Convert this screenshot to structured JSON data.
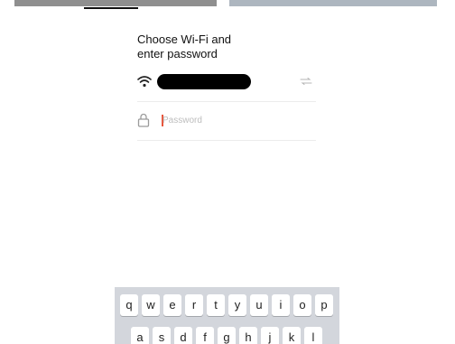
{
  "title": {
    "line1": "Choose Wi-Fi and",
    "line2": "enter password"
  },
  "wifi": {
    "icon": "wifi-icon",
    "network_name_redacted": true,
    "change_icon": "swap-icon"
  },
  "password": {
    "icon": "lock-icon",
    "placeholder": "Password",
    "value": ""
  },
  "keyboard": {
    "row1": [
      "q",
      "w",
      "e",
      "r",
      "t",
      "y",
      "u",
      "i",
      "o",
      "p"
    ],
    "row2": [
      "a",
      "s",
      "d",
      "f",
      "g",
      "h",
      "j",
      "k",
      "l"
    ]
  },
  "colors": {
    "accent_cursor": "#e8553b",
    "keyboard_bg": "#d3d6dc",
    "divider": "#ececec"
  }
}
